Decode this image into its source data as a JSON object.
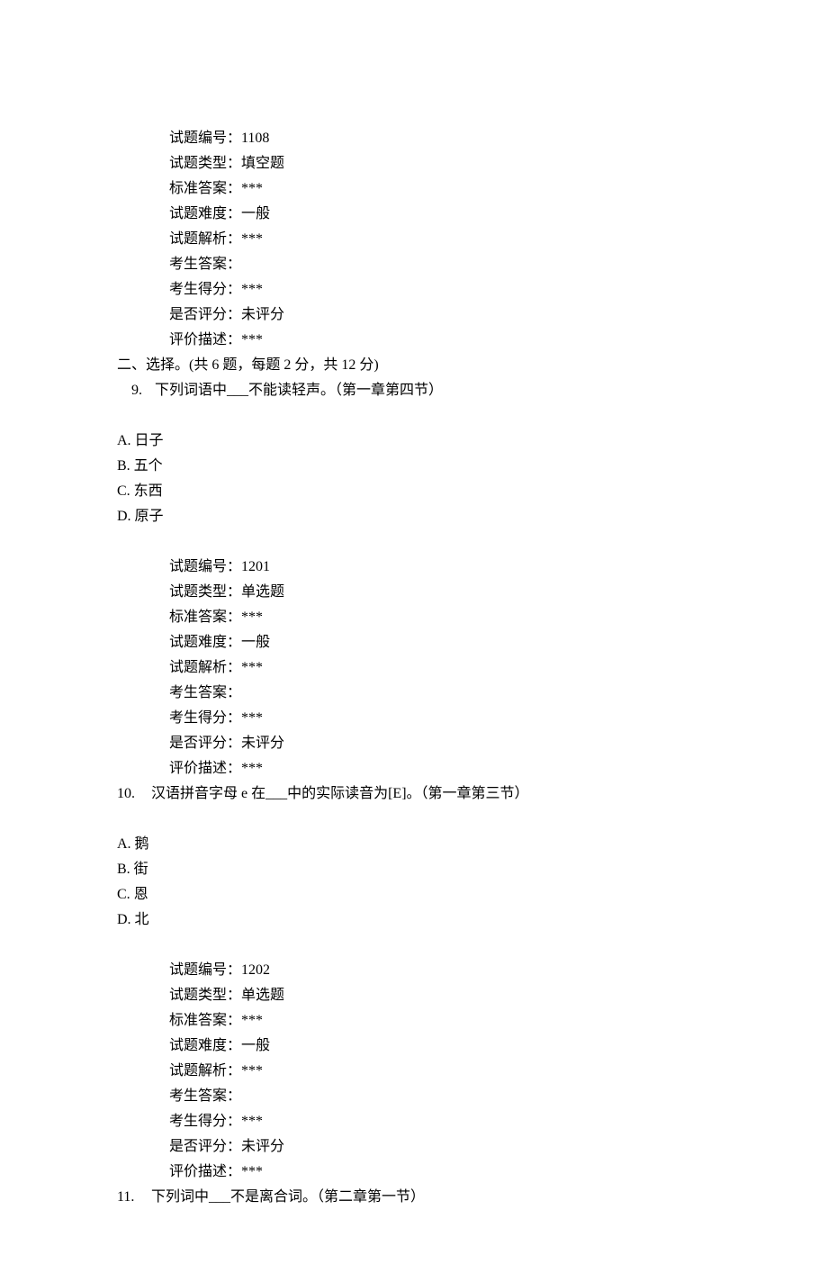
{
  "meta8": {
    "id_label": "试题编号：",
    "id_value": "1108",
    "type_label": "试题类型：",
    "type_value": "填空题",
    "answer_label": "标准答案：",
    "answer_value": "***",
    "difficulty_label": "试题难度：",
    "difficulty_value": "一般",
    "analysis_label": "试题解析：",
    "analysis_value": "***",
    "student_answer_label": "考生答案：",
    "student_answer_value": "",
    "score_label": "考生得分：",
    "score_value": "***",
    "graded_label": "是否评分：",
    "graded_value": "未评分",
    "desc_label": "评价描述：",
    "desc_value": "***"
  },
  "section2_heading": "二、选择。(共 6 题，每题 2 分，共 12 分)",
  "q9": {
    "number": "9.",
    "text": "下列词语中___不能读轻声。（第一章第四节）",
    "options": {
      "a": "A.  日子",
      "b": "B.  五个",
      "c": "C.  东西",
      "d": "D.  原子"
    }
  },
  "meta9": {
    "id_label": "试题编号：",
    "id_value": "1201",
    "type_label": "试题类型：",
    "type_value": "单选题",
    "answer_label": "标准答案：",
    "answer_value": "***",
    "difficulty_label": "试题难度：",
    "difficulty_value": "一般",
    "analysis_label": "试题解析：",
    "analysis_value": "***",
    "student_answer_label": "考生答案：",
    "student_answer_value": "",
    "score_label": "考生得分：",
    "score_value": "***",
    "graded_label": "是否评分：",
    "graded_value": "未评分",
    "desc_label": "评价描述：",
    "desc_value": "***"
  },
  "q10": {
    "number": "10.",
    "text": "汉语拼音字母 e 在___中的实际读音为[E]。（第一章第三节）",
    "options": {
      "a": "A.  鹅",
      "b": "B.  街",
      "c": "C.  恩",
      "d": "D.  北"
    }
  },
  "meta10": {
    "id_label": "试题编号：",
    "id_value": "1202",
    "type_label": "试题类型：",
    "type_value": "单选题",
    "answer_label": "标准答案：",
    "answer_value": "***",
    "difficulty_label": "试题难度：",
    "difficulty_value": "一般",
    "analysis_label": "试题解析：",
    "analysis_value": "***",
    "student_answer_label": "考生答案：",
    "student_answer_value": "",
    "score_label": "考生得分：",
    "score_value": "***",
    "graded_label": "是否评分：",
    "graded_value": "未评分",
    "desc_label": "评价描述：",
    "desc_value": "***"
  },
  "q11": {
    "number": "11.",
    "text": "下列词中___不是离合词。（第二章第一节）"
  }
}
